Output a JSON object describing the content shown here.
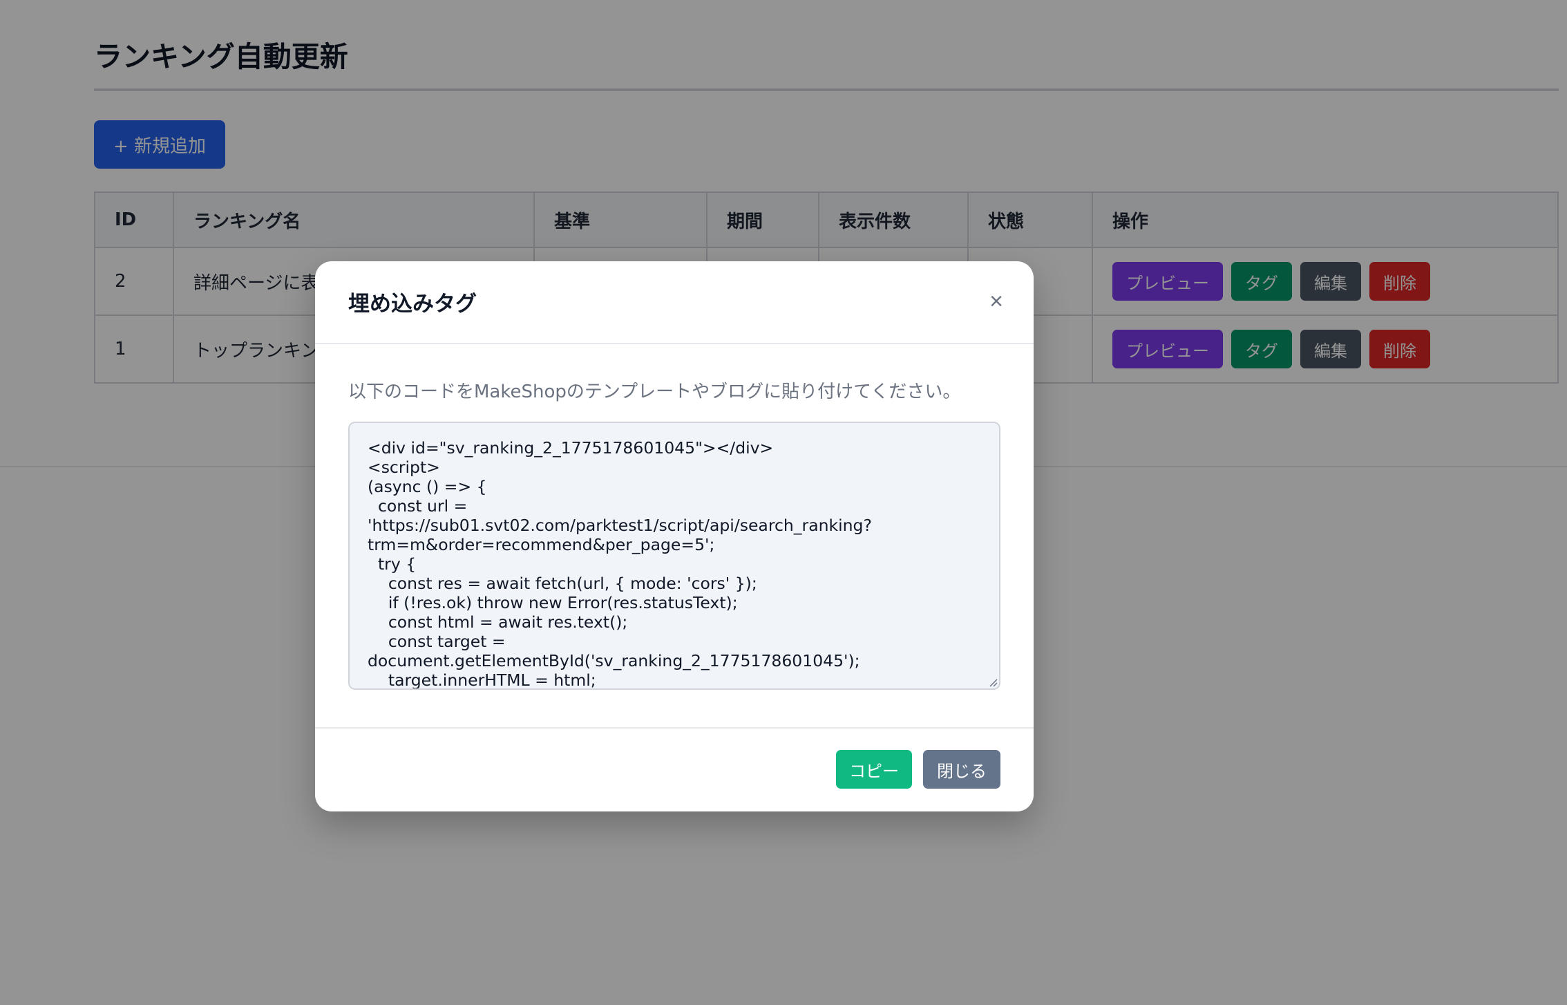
{
  "page": {
    "title": "ランキング自動更新",
    "new_button_label": "+ 新規追加"
  },
  "table": {
    "headers": [
      "ID",
      "ランキング名",
      "基準",
      "期間",
      "表示件数",
      "状態",
      "操作"
    ],
    "rows": [
      {
        "id": "2",
        "name": "詳細ページに表"
      },
      {
        "id": "1",
        "name": "トップランキン"
      }
    ],
    "actions": {
      "preview": "プレビュー",
      "tag": "タグ",
      "edit": "編集",
      "delete": "削除"
    }
  },
  "modal": {
    "title": "埋め込みタグ",
    "close_icon": "×",
    "description": "以下のコードをMakeShopのテンプレートやブログに貼り付けてください。",
    "code": "<div id=\"sv_ranking_2_1775178601045\"></div>\n<script>\n(async () => {\n  const url =\n'https://sub01.svt02.com/parktest1/script/api/search_ranking?\ntrm=m&order=recommend&per_page=5';\n  try {\n    const res = await fetch(url, { mode: 'cors' });\n    if (!res.ok) throw new Error(res.statusText);\n    const html = await res.text();\n    const target =\ndocument.getElementById('sv_ranking_2_1775178601045');\n    target.innerHTML = html;",
    "copy_label": "コピー",
    "close_label": "閉じる"
  },
  "colors": {
    "primary": "#2563eb",
    "preview": "#7c3aed",
    "tag": "#059669",
    "edit": "#4b5563",
    "delete": "#dc2626",
    "copy": "#10b981",
    "close": "#64748b"
  }
}
